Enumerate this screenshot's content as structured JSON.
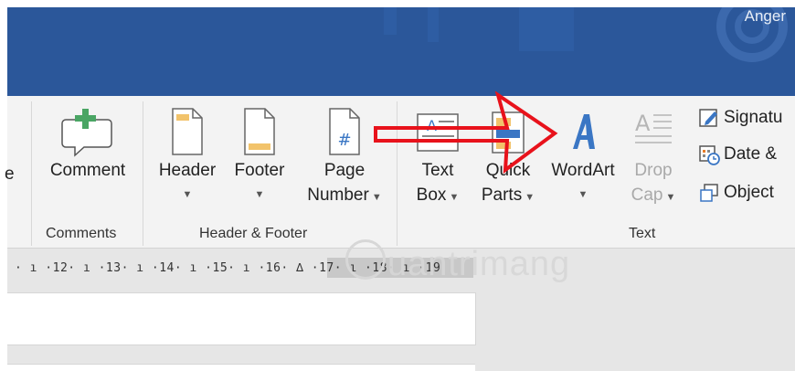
{
  "title_bar": {
    "user_name": "Anger"
  },
  "ribbon": {
    "comments_group": {
      "comment_label": "Comment",
      "group_label": "Comments"
    },
    "header_footer_group": {
      "header_label": "Header",
      "footer_label": "Footer",
      "page_number_line1": "Page",
      "page_number_line2": "Number",
      "group_label": "Header & Footer"
    },
    "text_group": {
      "text_box_line1": "Text",
      "text_box_line2": "Box",
      "quick_parts_line1": "Quick",
      "quick_parts_line2": "Parts",
      "wordart_label": "WordArt",
      "drop_cap_line1": "Drop",
      "drop_cap_line2": "Cap",
      "signature_label": "Signatu",
      "date_label": "Date &",
      "object_label": "Object",
      "group_label": "Text"
    },
    "cut_left_label": "e"
  },
  "ruler": {
    "text": "· ı ·12· ı ·13· ı ·14· ı ·15· ı ·16· ∆ ·17· ı ·18· ı ·19"
  },
  "watermark": {
    "text": "uantrimang"
  },
  "colors": {
    "titlebar": "#2b579a",
    "ribbon": "#f3f3f3",
    "arrow": "#e8121b",
    "wordart": "#3a76c4"
  }
}
